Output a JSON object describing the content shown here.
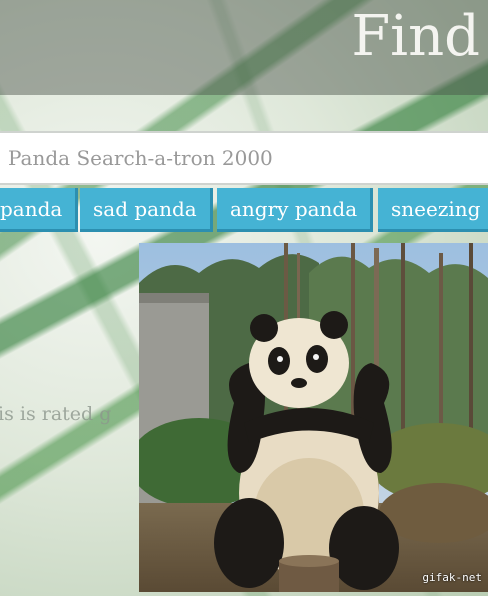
{
  "header": {
    "title": "Find"
  },
  "search": {
    "placeholder": "Panda Search-a-tron 2000",
    "value": ""
  },
  "tags": [
    {
      "label": "panda"
    },
    {
      "label": "sad panda"
    },
    {
      "label": "angry panda"
    },
    {
      "label": "sneezing"
    }
  ],
  "rating_text": "is is rated g",
  "result": {
    "watermark": "gifak-net",
    "subject": "panda-sitting"
  },
  "colors": {
    "tag_bg": "#45b3d4",
    "tag_shadow": "#2c8fb0",
    "header_overlay": "rgba(70,80,70,0.45)"
  }
}
